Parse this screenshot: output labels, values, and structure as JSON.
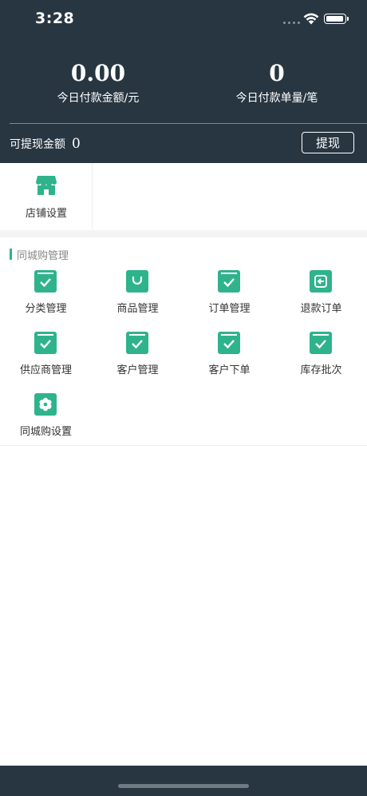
{
  "status_bar": {
    "time": "3:28"
  },
  "header": {
    "stats": [
      {
        "value": "0.00",
        "label": "今日付款金额/元"
      },
      {
        "value": "0",
        "label": "今日付款单量/笔"
      }
    ],
    "withdrawable": {
      "label": "可提现金额",
      "amount": "0"
    },
    "withdraw_button": "提现"
  },
  "store": {
    "label": "店铺设置",
    "icon": "storefront-icon"
  },
  "section": {
    "title": "同城购管理"
  },
  "menu_items": [
    {
      "label": "分类管理",
      "icon": "check-box-icon"
    },
    {
      "label": "商品管理",
      "icon": "shopping-bag-icon"
    },
    {
      "label": "订单管理",
      "icon": "check-box-icon"
    },
    {
      "label": "退款订单",
      "icon": "return-icon"
    },
    {
      "label": "供应商管理",
      "icon": "check-box-icon"
    },
    {
      "label": "客户管理",
      "icon": "check-box-icon"
    },
    {
      "label": "客户下单",
      "icon": "check-box-icon"
    },
    {
      "label": "库存批次",
      "icon": "check-box-icon"
    },
    {
      "label": "同城购设置",
      "icon": "flower-settings-icon"
    }
  ],
  "colors": {
    "header_bg": "#283641",
    "accent": "#2fb38c"
  }
}
